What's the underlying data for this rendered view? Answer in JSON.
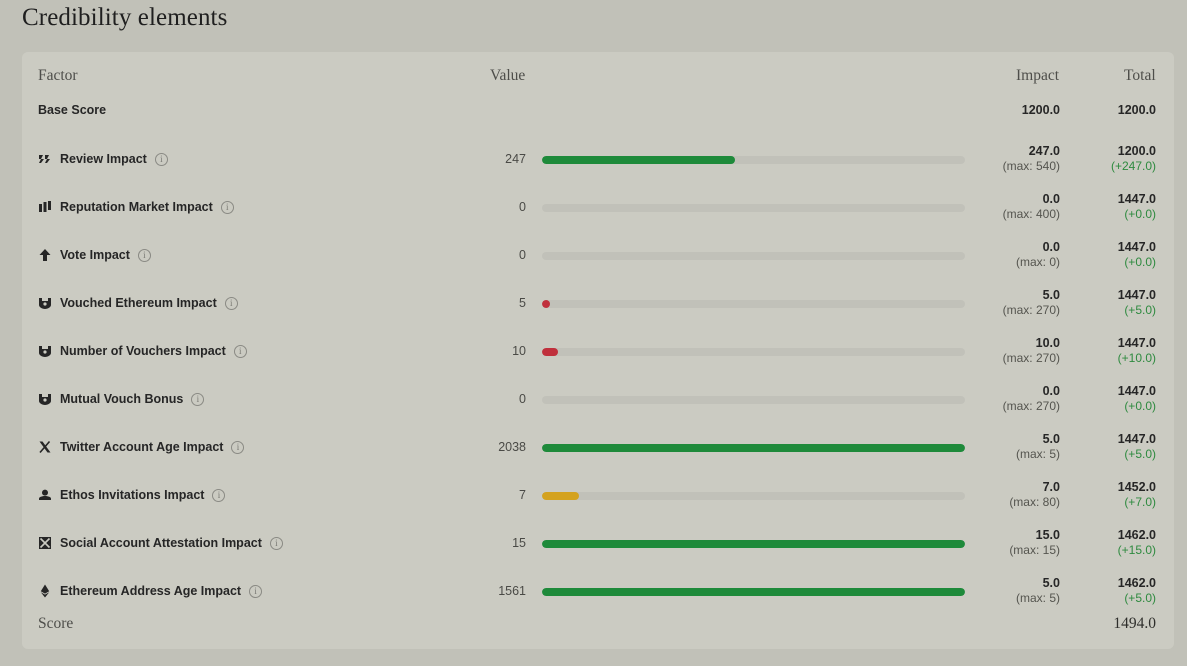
{
  "title": "Credibility elements",
  "headers": {
    "factor": "Factor",
    "value": "Value",
    "impact": "Impact",
    "total": "Total"
  },
  "base": {
    "label": "Base Score",
    "impact": "1200.0",
    "total": "1200.0"
  },
  "colors": {
    "green": "#1e8a3a",
    "red": "#c0303c",
    "yellow": "#d4a21e",
    "track": "#c1c1b9"
  },
  "rows": [
    {
      "label": "Review Impact",
      "icon": "review-icon",
      "value": "247",
      "fill": 0.457,
      "color": "green",
      "impact": "247.0",
      "max": "(max: 540)",
      "total": "1200.0",
      "delta": "(+247.0)"
    },
    {
      "label": "Reputation Market Impact",
      "icon": "market-icon",
      "value": "0",
      "fill": 0,
      "color": "green",
      "impact": "0.0",
      "max": "(max: 400)",
      "total": "1447.0",
      "delta": "(+0.0)"
    },
    {
      "label": "Vote Impact",
      "icon": "arrow-up-icon",
      "value": "0",
      "fill": 0,
      "color": "green",
      "impact": "0.0",
      "max": "(max: 0)",
      "total": "1447.0",
      "delta": "(+0.0)"
    },
    {
      "label": "Vouched Ethereum Impact",
      "icon": "vouch-icon",
      "value": "5",
      "fill": 0.019,
      "color": "red",
      "impact": "5.0",
      "max": "(max: 270)",
      "total": "1447.0",
      "delta": "(+5.0)"
    },
    {
      "label": "Number of Vouchers Impact",
      "icon": "vouch-icon",
      "value": "10",
      "fill": 0.037,
      "color": "red",
      "impact": "10.0",
      "max": "(max: 270)",
      "total": "1447.0",
      "delta": "(+10.0)"
    },
    {
      "label": "Mutual Vouch Bonus",
      "icon": "vouch-icon",
      "value": "0",
      "fill": 0,
      "color": "green",
      "impact": "0.0",
      "max": "(max: 270)",
      "total": "1447.0",
      "delta": "(+0.0)"
    },
    {
      "label": "Twitter Account Age Impact",
      "icon": "x-logo-icon",
      "value": "2038",
      "fill": 1.0,
      "color": "green",
      "impact": "5.0",
      "max": "(max: 5)",
      "total": "1447.0",
      "delta": "(+5.0)"
    },
    {
      "label": "Ethos Invitations Impact",
      "icon": "invite-icon",
      "value": "7",
      "fill": 0.0875,
      "color": "yellow",
      "impact": "7.0",
      "max": "(max: 80)",
      "total": "1452.0",
      "delta": "(+7.0)"
    },
    {
      "label": "Social Account Attestation Impact",
      "icon": "attestation-icon",
      "value": "15",
      "fill": 1.0,
      "color": "green",
      "impact": "15.0",
      "max": "(max: 15)",
      "total": "1462.0",
      "delta": "(+15.0)"
    },
    {
      "label": "Ethereum Address Age Impact",
      "icon": "ethereum-icon",
      "value": "1561",
      "fill": 1.0,
      "color": "green",
      "impact": "5.0",
      "max": "(max: 5)",
      "total": "1462.0",
      "delta": "(+5.0)"
    }
  ],
  "score": {
    "label": "Score",
    "value": "1494.0"
  }
}
